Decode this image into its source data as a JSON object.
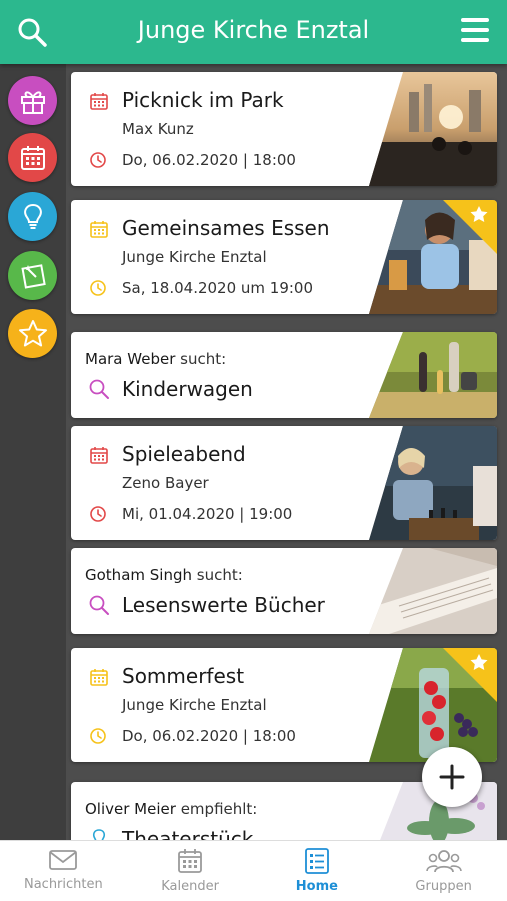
{
  "header": {
    "title": "Junge Kirche Enztal"
  },
  "sidebar": {
    "categories": [
      {
        "name": "gift",
        "color": "#c84ec0"
      },
      {
        "name": "calendar",
        "color": "#e24848"
      },
      {
        "name": "lightbulb",
        "color": "#2aa7d6"
      },
      {
        "name": "note",
        "color": "#58b84a"
      },
      {
        "name": "star",
        "color": "#f6b21a"
      }
    ]
  },
  "feed": {
    "cards": [
      {
        "type": "event",
        "title": "Picknick im Park",
        "subtitle": "Max Kunz",
        "date": "Do, 06.02.2020 | 18:00",
        "icon_color": "#e24848",
        "featured": false
      },
      {
        "type": "event",
        "title": "Gemeinsames Essen",
        "subtitle": "Junge Kirche Enztal",
        "date": "Sa, 18.04.2020 um 19:00",
        "icon_color": "#f6c21a",
        "featured": true
      },
      {
        "type": "search",
        "person": "Mara Weber",
        "verb": "sucht:",
        "title": "Kinderwagen"
      },
      {
        "type": "event",
        "title": "Spieleabend",
        "subtitle": "Zeno Bayer",
        "date": "Mi, 01.04.2020 | 19:00",
        "icon_color": "#e24848",
        "featured": false
      },
      {
        "type": "search",
        "person": "Gotham Singh",
        "verb": "sucht:",
        "title": "Lesenswerte Bücher"
      },
      {
        "type": "event",
        "title": "Sommerfest",
        "subtitle": "Junge Kirche Enztal",
        "date": "Do, 06.02.2020 | 18:00",
        "icon_color": "#f6c21a",
        "featured": true
      },
      {
        "type": "recommend",
        "person": "Oliver Meier",
        "verb": "empfiehlt:",
        "title": "Theaterstück"
      }
    ]
  },
  "tabbar": {
    "tabs": [
      {
        "label": "Nachrichten",
        "active": false
      },
      {
        "label": "Kalender",
        "active": false
      },
      {
        "label": "Home",
        "active": true
      },
      {
        "label": "Gruppen",
        "active": false
      }
    ]
  },
  "colors": {
    "brand": "#2cb88e",
    "active_tab": "#1e8fd6",
    "featured_ribbon": "#f6c21a"
  }
}
